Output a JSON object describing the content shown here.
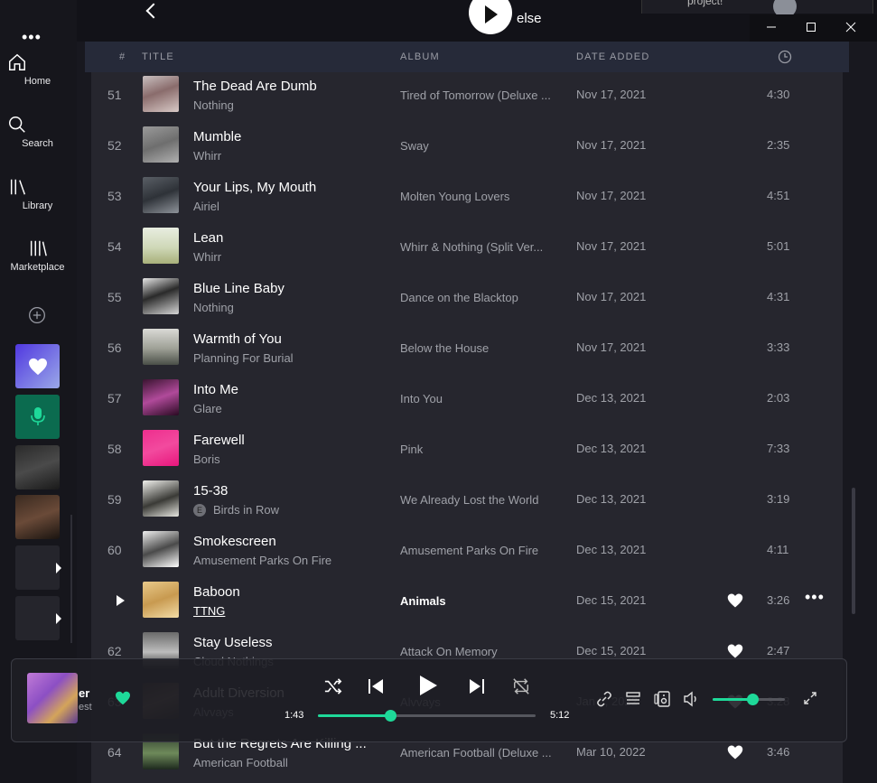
{
  "window": {
    "title_fragment": "else",
    "notification_fragment": "project!",
    "controls": [
      "minimize",
      "maximize",
      "close"
    ]
  },
  "sidebar": {
    "items": [
      {
        "label": "Home",
        "icon": "home-icon"
      },
      {
        "label": "Search",
        "icon": "search-icon"
      },
      {
        "label": "Library",
        "icon": "library-icon"
      },
      {
        "label": "Marketplace",
        "icon": "marketplace-icon"
      }
    ],
    "more_glyph": "•••"
  },
  "table": {
    "headers": {
      "num": "#",
      "title": "TITLE",
      "album": "ALBUM",
      "date": "DATE ADDED",
      "duration_icon": "clock-icon"
    },
    "rows": [
      {
        "num": "51",
        "title": "The Dead Are Dumb",
        "artist": "Nothing",
        "album": "Tired of Tomorrow (Deluxe ...",
        "date": "Nov 17, 2021",
        "duration": "4:30",
        "liked": false
      },
      {
        "num": "52",
        "title": "Mumble",
        "artist": "Whirr",
        "album": "Sway",
        "date": "Nov 17, 2021",
        "duration": "2:35",
        "liked": false
      },
      {
        "num": "53",
        "title": "Your Lips, My Mouth",
        "artist": "Airiel",
        "album": "Molten Young Lovers",
        "date": "Nov 17, 2021",
        "duration": "4:51",
        "liked": false
      },
      {
        "num": "54",
        "title": "Lean",
        "artist": "Whirr",
        "album": "Whirr & Nothing (Split Ver...",
        "date": "Nov 17, 2021",
        "duration": "5:01",
        "liked": false
      },
      {
        "num": "55",
        "title": "Blue Line Baby",
        "artist": "Nothing",
        "album": "Dance on the Blacktop",
        "date": "Nov 17, 2021",
        "duration": "4:31",
        "liked": false
      },
      {
        "num": "56",
        "title": "Warmth of You",
        "artist": "Planning For Burial",
        "album": "Below the House",
        "date": "Nov 17, 2021",
        "duration": "3:33",
        "liked": false
      },
      {
        "num": "57",
        "title": "Into Me",
        "artist": "Glare",
        "album": "Into You",
        "date": "Dec 13, 2021",
        "duration": "2:03",
        "liked": false
      },
      {
        "num": "58",
        "title": "Farewell",
        "artist": "Boris",
        "album": "Pink",
        "date": "Dec 13, 2021",
        "duration": "7:33",
        "liked": false
      },
      {
        "num": "59",
        "title": "15-38",
        "artist": "Birds in Row",
        "album": "We Already Lost the World",
        "date": "Dec 13, 2021",
        "duration": "3:19",
        "liked": false,
        "explicit": "E"
      },
      {
        "num": "60",
        "title": "Smokescreen",
        "artist": "Amusement Parks On Fire",
        "album": "Amusement Parks On Fire",
        "date": "Dec 13, 2021",
        "duration": "4:11",
        "liked": false
      },
      {
        "num": "61",
        "title": "Baboon",
        "artist": "TTNG",
        "album": "Animals",
        "date": "Dec 15, 2021",
        "duration": "3:26",
        "liked": true,
        "active": true
      },
      {
        "num": "62",
        "title": "Stay Useless",
        "artist": "Cloud Nothings",
        "album": "Attack On Memory",
        "date": "Dec 15, 2021",
        "duration": "2:47",
        "liked": true
      },
      {
        "num": "63",
        "title": "Adult Diversion",
        "artist": "Alvvays",
        "album": "Alvvays",
        "date": "Jan 2, 2022",
        "duration": "3:28",
        "liked": true
      },
      {
        "num": "64",
        "title": "But the Regrets Are Killing ...",
        "artist": "American Football",
        "album": "American Football (Deluxe ...",
        "date": "Mar 10, 2022",
        "duration": "3:46",
        "liked": true
      }
    ]
  },
  "player": {
    "track_fragment": "er",
    "artist_fragment": "est",
    "elapsed": "1:43",
    "total": "5:12",
    "progress": 0.33,
    "volume": 0.55,
    "accent": "#1ed999"
  }
}
